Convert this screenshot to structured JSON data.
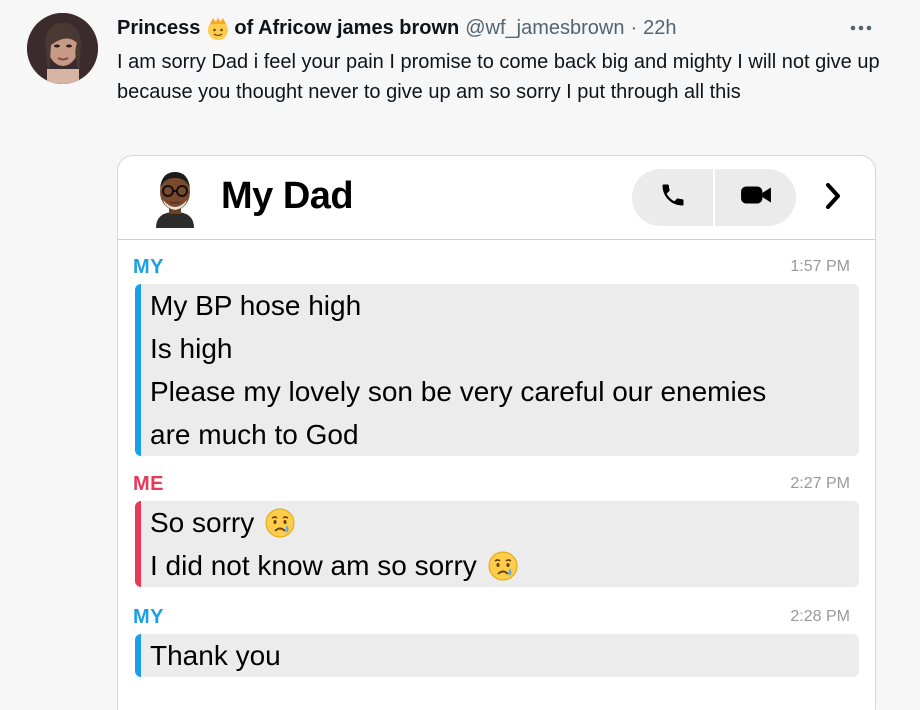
{
  "tweet": {
    "display_name_part1": "Princess",
    "display_name_emoji": "princess-emoji",
    "display_name_part2": "of Africow james brown",
    "handle": "@wf_jamesbrown",
    "separator": "·",
    "time": "22h",
    "text": "I am sorry Dad i feel your pain I promise to come back big and mighty I will not give up because you thought never to give up am so sorry I put through all this"
  },
  "chat": {
    "title": "My Dad",
    "avatar_icon": "dad-bitmoji-icon",
    "actions": [
      "phone-icon",
      "video-icon",
      "chevron-right-icon"
    ],
    "messages": [
      {
        "sender": "MY",
        "time": "1:57 PM",
        "color": "#1aa0e6",
        "lines": [
          "My BP hose high",
          "Is high",
          "Please my lovely son be very careful our enemies",
          "are much to God"
        ]
      },
      {
        "sender": "ME",
        "time": "2:27 PM",
        "color": "#e83a58",
        "lines": [
          "So sorry",
          "I did not know am so sorry"
        ],
        "emoji": "crying-face-emoji"
      },
      {
        "sender": "MY",
        "time": "2:28 PM",
        "color": "#1aa0e6",
        "lines": [
          "Thank you"
        ]
      }
    ]
  },
  "colors": {
    "accent_blue": "#1aa0e6",
    "accent_red": "#e83a58",
    "bubble_bg": "#ececec",
    "text_secondary": "#536471"
  }
}
